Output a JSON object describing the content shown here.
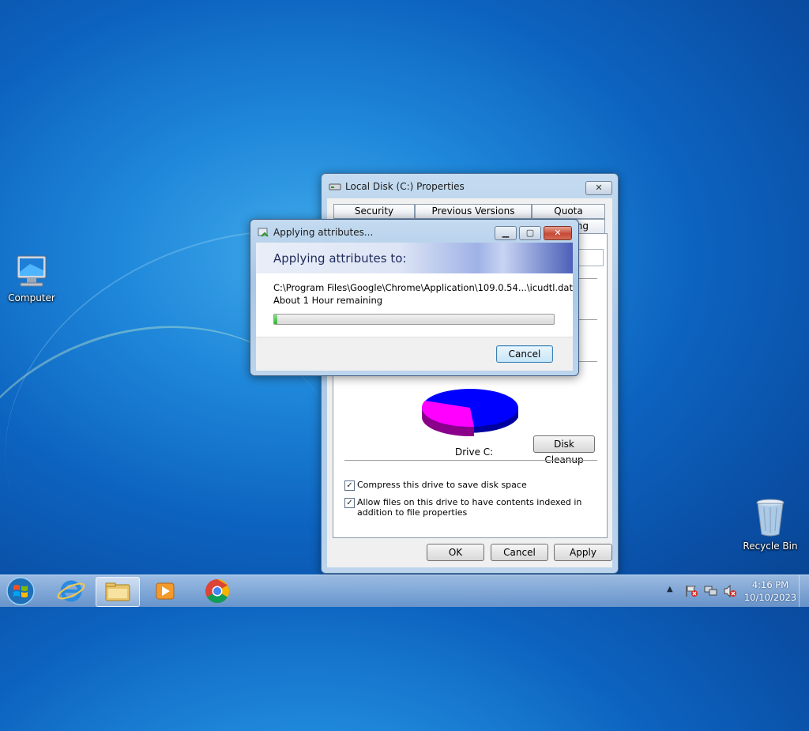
{
  "desktop": {
    "icons": [
      {
        "label": "Computer",
        "icon": "computer-icon"
      },
      {
        "label": "Recycle Bin",
        "icon": "recycle-bin-icon"
      }
    ]
  },
  "properties_window": {
    "title": "Local Disk (C:) Properties",
    "close_glyph": "✕",
    "tabs_row1": [
      "Security",
      "Previous Versions",
      "Quota"
    ],
    "tabs_row2_visible": "ng",
    "drive_label": "Drive C:",
    "disk_cleanup_label": "Disk Cleanup",
    "compress_label": "Compress this drive to save disk space",
    "compress_checked": true,
    "index_label": "Allow files on this drive to have contents indexed in addition to file properties",
    "index_checked": true,
    "ok_label": "OK",
    "cancel_label": "Cancel",
    "apply_label": "Apply",
    "pie": {
      "used_color": "#0000ff",
      "free_color": "#ff00ff",
      "used_fraction": 0.72
    }
  },
  "progress_dialog": {
    "title": "Applying attributes...",
    "header": "Applying attributes to:",
    "path": "C:\\Program Files\\Google\\Chrome\\Application\\109.0.54...\\icudtl.dat",
    "time_remaining": "About 1 Hour remaining",
    "progress_fraction": 0.01,
    "cancel_label": "Cancel"
  },
  "taskbar": {
    "apps": [
      "start-orb",
      "internet-explorer-icon",
      "file-explorer-icon",
      "media-player-icon",
      "chrome-icon"
    ],
    "clock_time": "4:16 PM",
    "clock_date": "10/10/2023"
  }
}
